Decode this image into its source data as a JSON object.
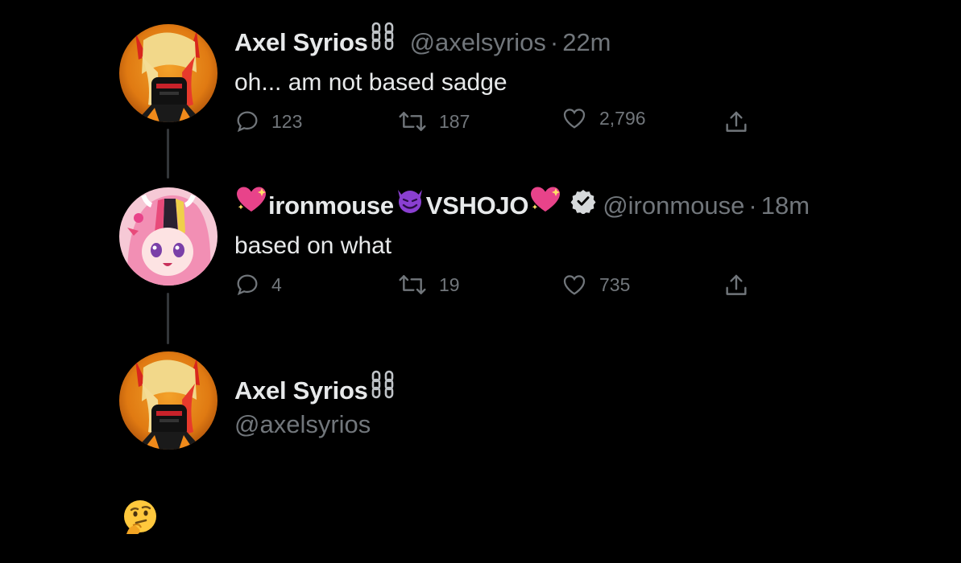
{
  "tweets": [
    {
      "display_name": "Axel Syrios",
      "name_suffix_icon": "chain-link-icon",
      "handle": "@axelsyrios",
      "separator": "·",
      "time": "22m",
      "text": "oh... am not based sadge",
      "replies": "123",
      "retweets": "187",
      "likes": "2,796"
    },
    {
      "display_name_prefix_icon": "sparkling-heart-emoji",
      "display_name": "ironmouse",
      "display_name_mid_icon": "smiling-devil-emoji",
      "display_name_suffix": "VSHOJO",
      "display_name_suffix_icon": "sparkling-heart-emoji",
      "verified_icon": "verified-badge-icon",
      "handle": "@ironmouse",
      "separator": "·",
      "time": "18m",
      "text": "based on what",
      "replies": "4",
      "retweets": "19",
      "likes": "735"
    }
  ],
  "composer": {
    "display_name": "Axel Syrios",
    "name_suffix_icon": "chain-link-icon",
    "handle": "@axelsyrios",
    "draft_emoji": "thinking-face-emoji"
  },
  "colors": {
    "background": "#000000",
    "primary_text": "#e7e9ea",
    "secondary_text": "#71767b",
    "thread_line": "#333639",
    "heart_pink": "#e8438a",
    "devil_purple": "#8a3fd1"
  }
}
